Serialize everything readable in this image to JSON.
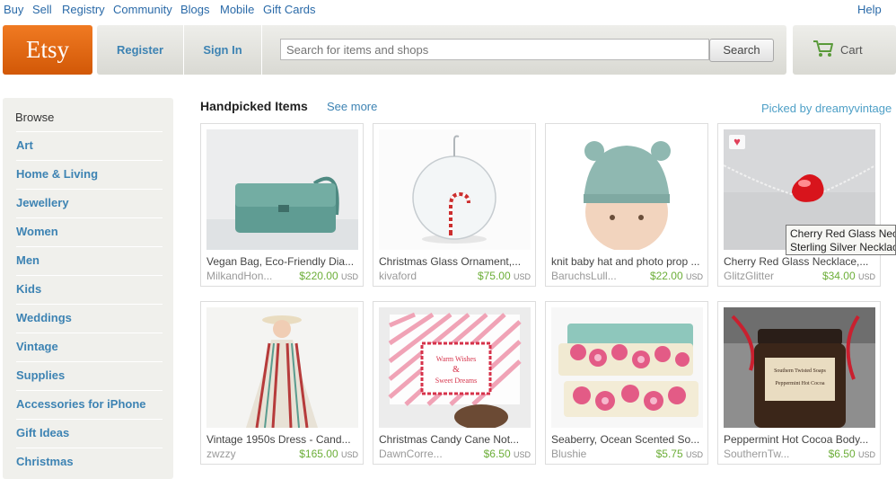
{
  "top_nav": {
    "items": [
      "Buy",
      "Sell",
      "Registry",
      "Community",
      "Blogs",
      "Mobile",
      "Gift Cards"
    ],
    "help": "Help"
  },
  "header": {
    "logo": "Etsy",
    "register": "Register",
    "sign_in": "Sign In",
    "search_placeholder": "Search for items and shops",
    "search_button": "Search",
    "cart": "Cart",
    "cart_icon": "shopping-cart-icon"
  },
  "sidebar": {
    "title": "Browse",
    "items": [
      "Art",
      "Home & Living",
      "Jewellery",
      "Women",
      "Men",
      "Kids",
      "Weddings",
      "Vintage",
      "Supplies",
      "Accessories for iPhone",
      "Gift Ideas",
      "Christmas"
    ]
  },
  "main": {
    "heading": "Handpicked Items",
    "see_more": "See more",
    "picked_by": "Picked by dreamyvintage",
    "items": [
      {
        "title": "Vegan Bag, Eco-Friendly Dia...",
        "shop": "MilkandHon...",
        "price": "$220.00",
        "currency": "USD"
      },
      {
        "title": "Christmas Glass Ornament,...",
        "shop": "kivaford",
        "price": "$75.00",
        "currency": "USD"
      },
      {
        "title": "knit baby hat and photo prop ...",
        "shop": "BaruchsLull...",
        "price": "$22.00",
        "currency": "USD"
      },
      {
        "title": "Cherry Red Glass Necklace,...",
        "shop": "GlitzGlitter",
        "price": "$34.00",
        "currency": "USD"
      },
      {
        "title": "Vintage 1950s Dress - Cand...",
        "shop": "zwzzy",
        "price": "$165.00",
        "currency": "USD"
      },
      {
        "title": "Christmas Candy Cane Not...",
        "shop": "DawnCorre...",
        "price": "$6.50",
        "currency": "USD"
      },
      {
        "title": "Seaberry, Ocean Scented So...",
        "shop": "Blushie",
        "price": "$5.75",
        "currency": "USD"
      },
      {
        "title": "Peppermint Hot Cocoa Body...",
        "shop": "SouthernTw...",
        "price": "$6.50",
        "currency": "USD"
      }
    ],
    "tooltip": {
      "line1": "Cherry Red Glass Neck",
      "line2": "Sterling Silver Necklace"
    },
    "favorite_icon": "heart-icon",
    "card_text": {
      "note_line1": "Warm Wishes",
      "note_amp": "&",
      "note_line2": "Sweet Dreams",
      "jar_line1": "Southern Twisted Soaps",
      "jar_line2": "Peppermint Hot Cocoa"
    }
  },
  "colors": {
    "logo_orange": "#e1670f",
    "link_blue": "#3d83b3",
    "price_green": "#6cae38"
  }
}
